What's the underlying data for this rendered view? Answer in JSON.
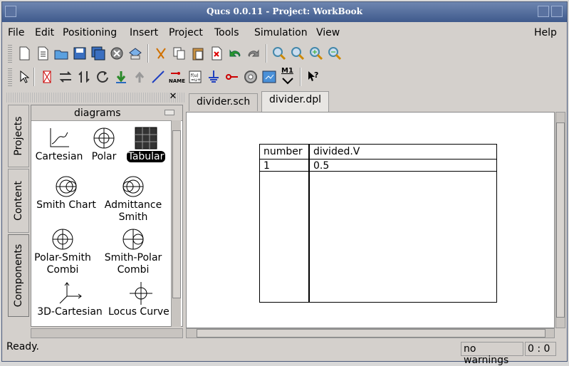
{
  "window": {
    "title": "Qucs 0.0.11 - Project: WorkBook"
  },
  "menubar": {
    "items": [
      {
        "label": "File"
      },
      {
        "label": "Edit"
      },
      {
        "label": "Positioning"
      },
      {
        "label": "Insert"
      },
      {
        "label": "Project"
      },
      {
        "label": "Tools"
      },
      {
        "label": "Simulation"
      },
      {
        "label": "View"
      }
    ],
    "help": "Help"
  },
  "toolbar1": {
    "icons": [
      "new-file-icon",
      "new-text-icon",
      "open-folder-icon",
      "save-icon",
      "save-all-icon",
      "close-icon",
      "print-icon",
      "cut-icon",
      "copy-icon",
      "paste-icon",
      "delete-icon",
      "undo-icon",
      "redo-icon",
      "zoom-fit-icon",
      "zoom-1to1-icon",
      "zoom-in-icon",
      "zoom-out-icon"
    ]
  },
  "toolbar2": {
    "icons": [
      "select-arrow-icon",
      "deactivate-icon",
      "mirror-x-icon",
      "mirror-y-icon",
      "rotate-icon",
      "enter-subcircuit-icon",
      "pop-out-icon",
      "wire-icon",
      "wire-label-icon",
      "equation-icon",
      "ground-icon",
      "port-icon",
      "simulate-icon",
      "dpl-switch-icon",
      "marker-icon",
      "whats-this-icon"
    ],
    "name_label": "NAME",
    "marker_label": "M1"
  },
  "dock": {
    "tabs": [
      "Projects",
      "Content",
      "Components"
    ],
    "active_tab": "Components",
    "combo_value": "diagrams",
    "items": [
      {
        "label": "Cartesian",
        "icon": "cartesian-diagram-icon"
      },
      {
        "label": "Polar",
        "icon": "polar-diagram-icon"
      },
      {
        "label": "Tabular",
        "icon": "tabular-diagram-icon",
        "selected": true
      },
      {
        "label": "Smith Chart",
        "icon": "smith-chart-icon"
      },
      {
        "label": "Admittance Smith",
        "icon": "admittance-smith-icon"
      },
      {
        "label": "Polar-Smith Combi",
        "icon": "polar-smith-combi-icon"
      },
      {
        "label": "Smith-Polar Combi",
        "icon": "smith-polar-combi-icon"
      },
      {
        "label": "3D-Cartesian",
        "icon": "3d-cartesian-icon"
      },
      {
        "label": "Locus Curve",
        "icon": "locus-curve-icon"
      }
    ]
  },
  "tabs": [
    {
      "label": "divider.sch",
      "active": false
    },
    {
      "label": "divider.dpl",
      "active": true
    }
  ],
  "table": {
    "headers": [
      "number",
      "divided.V"
    ],
    "rows": [
      [
        "1",
        "0.5"
      ]
    ]
  },
  "status": {
    "text": "Ready.",
    "warnings": "no warnings",
    "position": "0 : 0"
  }
}
